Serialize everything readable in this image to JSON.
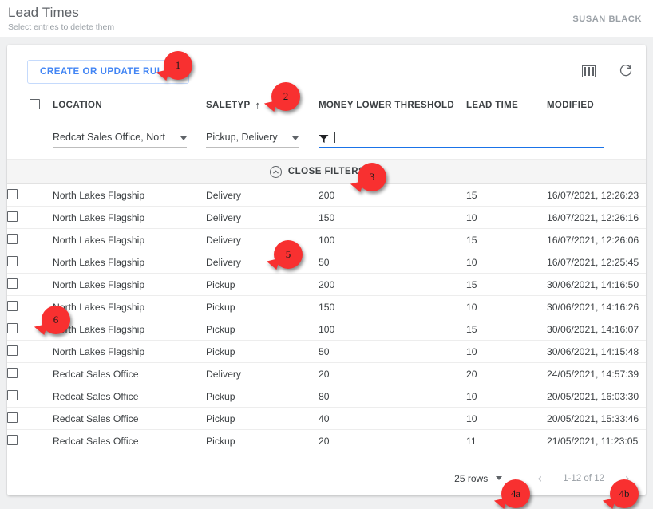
{
  "header": {
    "title": "Lead Times",
    "subtitle": "Select entries to delete them",
    "user": "SUSAN BLACK"
  },
  "toolbar": {
    "create_rules_label": "CREATE OR UPDATE RULES",
    "columns_icon": "columns-icon",
    "refresh_icon": "refresh-icon"
  },
  "table": {
    "columns": [
      {
        "key": "location",
        "label": "LOCATION",
        "sorted": false
      },
      {
        "key": "saletype",
        "label": "SALETYP",
        "sorted": true,
        "sort_arrow": "↑"
      },
      {
        "key": "money",
        "label": "MONEY LOWER THRESHOLD",
        "sorted": false
      },
      {
        "key": "lead",
        "label": "LEAD TIME",
        "sorted": false
      },
      {
        "key": "modified",
        "label": "MODIFIED",
        "sorted": false
      }
    ],
    "filters": {
      "location_value": "Redcat Sales Office, Nort",
      "saletype_value": "Pickup, Delivery",
      "search_value": "",
      "search_icon": "filter-funnel-icon"
    },
    "close_filters_label": "CLOSE FILTERS",
    "rows": [
      {
        "location": "North Lakes Flagship",
        "saletype": "Delivery",
        "money": "200",
        "lead": "15",
        "modified": "16/07/2021, 12:26:23"
      },
      {
        "location": "North Lakes Flagship",
        "saletype": "Delivery",
        "money": "150",
        "lead": "10",
        "modified": "16/07/2021, 12:26:16"
      },
      {
        "location": "North Lakes Flagship",
        "saletype": "Delivery",
        "money": "100",
        "lead": "15",
        "modified": "16/07/2021, 12:26:06"
      },
      {
        "location": "North Lakes Flagship",
        "saletype": "Delivery",
        "money": "50",
        "lead": "10",
        "modified": "16/07/2021, 12:25:45"
      },
      {
        "location": "North Lakes Flagship",
        "saletype": "Pickup",
        "money": "200",
        "lead": "15",
        "modified": "30/06/2021, 14:16:50"
      },
      {
        "location": "North Lakes Flagship",
        "saletype": "Pickup",
        "money": "150",
        "lead": "10",
        "modified": "30/06/2021, 14:16:26"
      },
      {
        "location": "North Lakes Flagship",
        "saletype": "Pickup",
        "money": "100",
        "lead": "15",
        "modified": "30/06/2021, 14:16:07"
      },
      {
        "location": "North Lakes Flagship",
        "saletype": "Pickup",
        "money": "50",
        "lead": "10",
        "modified": "30/06/2021, 14:15:48"
      },
      {
        "location": "Redcat Sales Office",
        "saletype": "Delivery",
        "money": "20",
        "lead": "20",
        "modified": "24/05/2021, 14:57:39"
      },
      {
        "location": "Redcat Sales Office",
        "saletype": "Pickup",
        "money": "80",
        "lead": "10",
        "modified": "20/05/2021, 16:03:30"
      },
      {
        "location": "Redcat Sales Office",
        "saletype": "Pickup",
        "money": "40",
        "lead": "10",
        "modified": "20/05/2021, 15:33:46"
      },
      {
        "location": "Redcat Sales Office",
        "saletype": "Pickup",
        "money": "20",
        "lead": "11",
        "modified": "21/05/2021, 11:23:05"
      }
    ]
  },
  "pagination": {
    "rows_per_page": "25 rows",
    "range": "1-12 of 12",
    "prev_icon": "‹",
    "next_icon": "›"
  },
  "callouts": [
    {
      "id": "1",
      "label": "1"
    },
    {
      "id": "2",
      "label": "2"
    },
    {
      "id": "3",
      "label": "3"
    },
    {
      "id": "4a",
      "label": "4a"
    },
    {
      "id": "4b",
      "label": "4b"
    },
    {
      "id": "5",
      "label": "5"
    },
    {
      "id": "6",
      "label": "6"
    }
  ],
  "colors": {
    "accent": "#4285f4",
    "focus_underline": "#1a73e8",
    "callout": "#f83030",
    "page_bg": "#eff0f1"
  }
}
